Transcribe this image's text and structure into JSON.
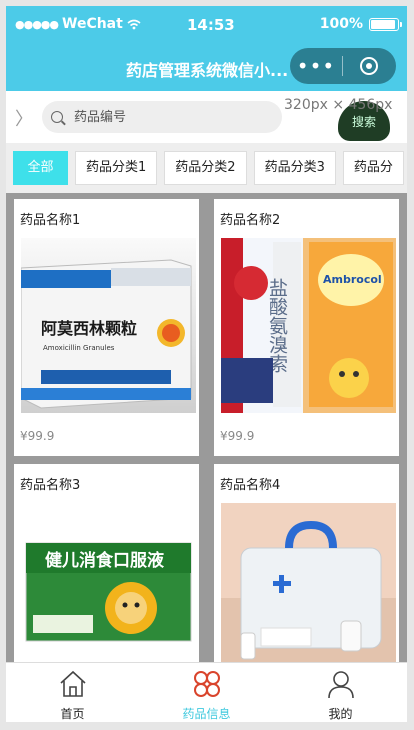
{
  "status_bar": {
    "carrier": "WeChat",
    "time": "14:53",
    "battery": "100%"
  },
  "nav": {
    "title": "药店管理系统微信小...",
    "more_icon": "more-dots-icon",
    "target_icon": "target-icon"
  },
  "search": {
    "placeholder": "药品编号",
    "button_label": "搜索",
    "dims_label": "320px × 456px"
  },
  "categories": [
    "全部",
    "药品分类1",
    "药品分类2",
    "药品分类3",
    "药品分"
  ],
  "products": [
    {
      "name": "药品名称1",
      "price": "¥99.9",
      "image_text": "阿莫西林颗粒",
      "image_sub": "Amoxicillin Granules"
    },
    {
      "name": "药品名称2",
      "price": "¥99.9",
      "image_text": "盐酸氨溴索口服溶液",
      "image_sub": "Ambrocol"
    },
    {
      "name": "药品名称3",
      "price": "",
      "image_text": "健儿消食口服液"
    },
    {
      "name": "药品名称4",
      "price": ""
    }
  ],
  "tabbar": {
    "items": [
      {
        "label": "首页"
      },
      {
        "label": "药品信息"
      },
      {
        "label": "我的"
      }
    ]
  },
  "colors": {
    "accent": "#4ccbe8",
    "tab_active": "#3fc9de",
    "tag_active": "#3ee0ea"
  }
}
